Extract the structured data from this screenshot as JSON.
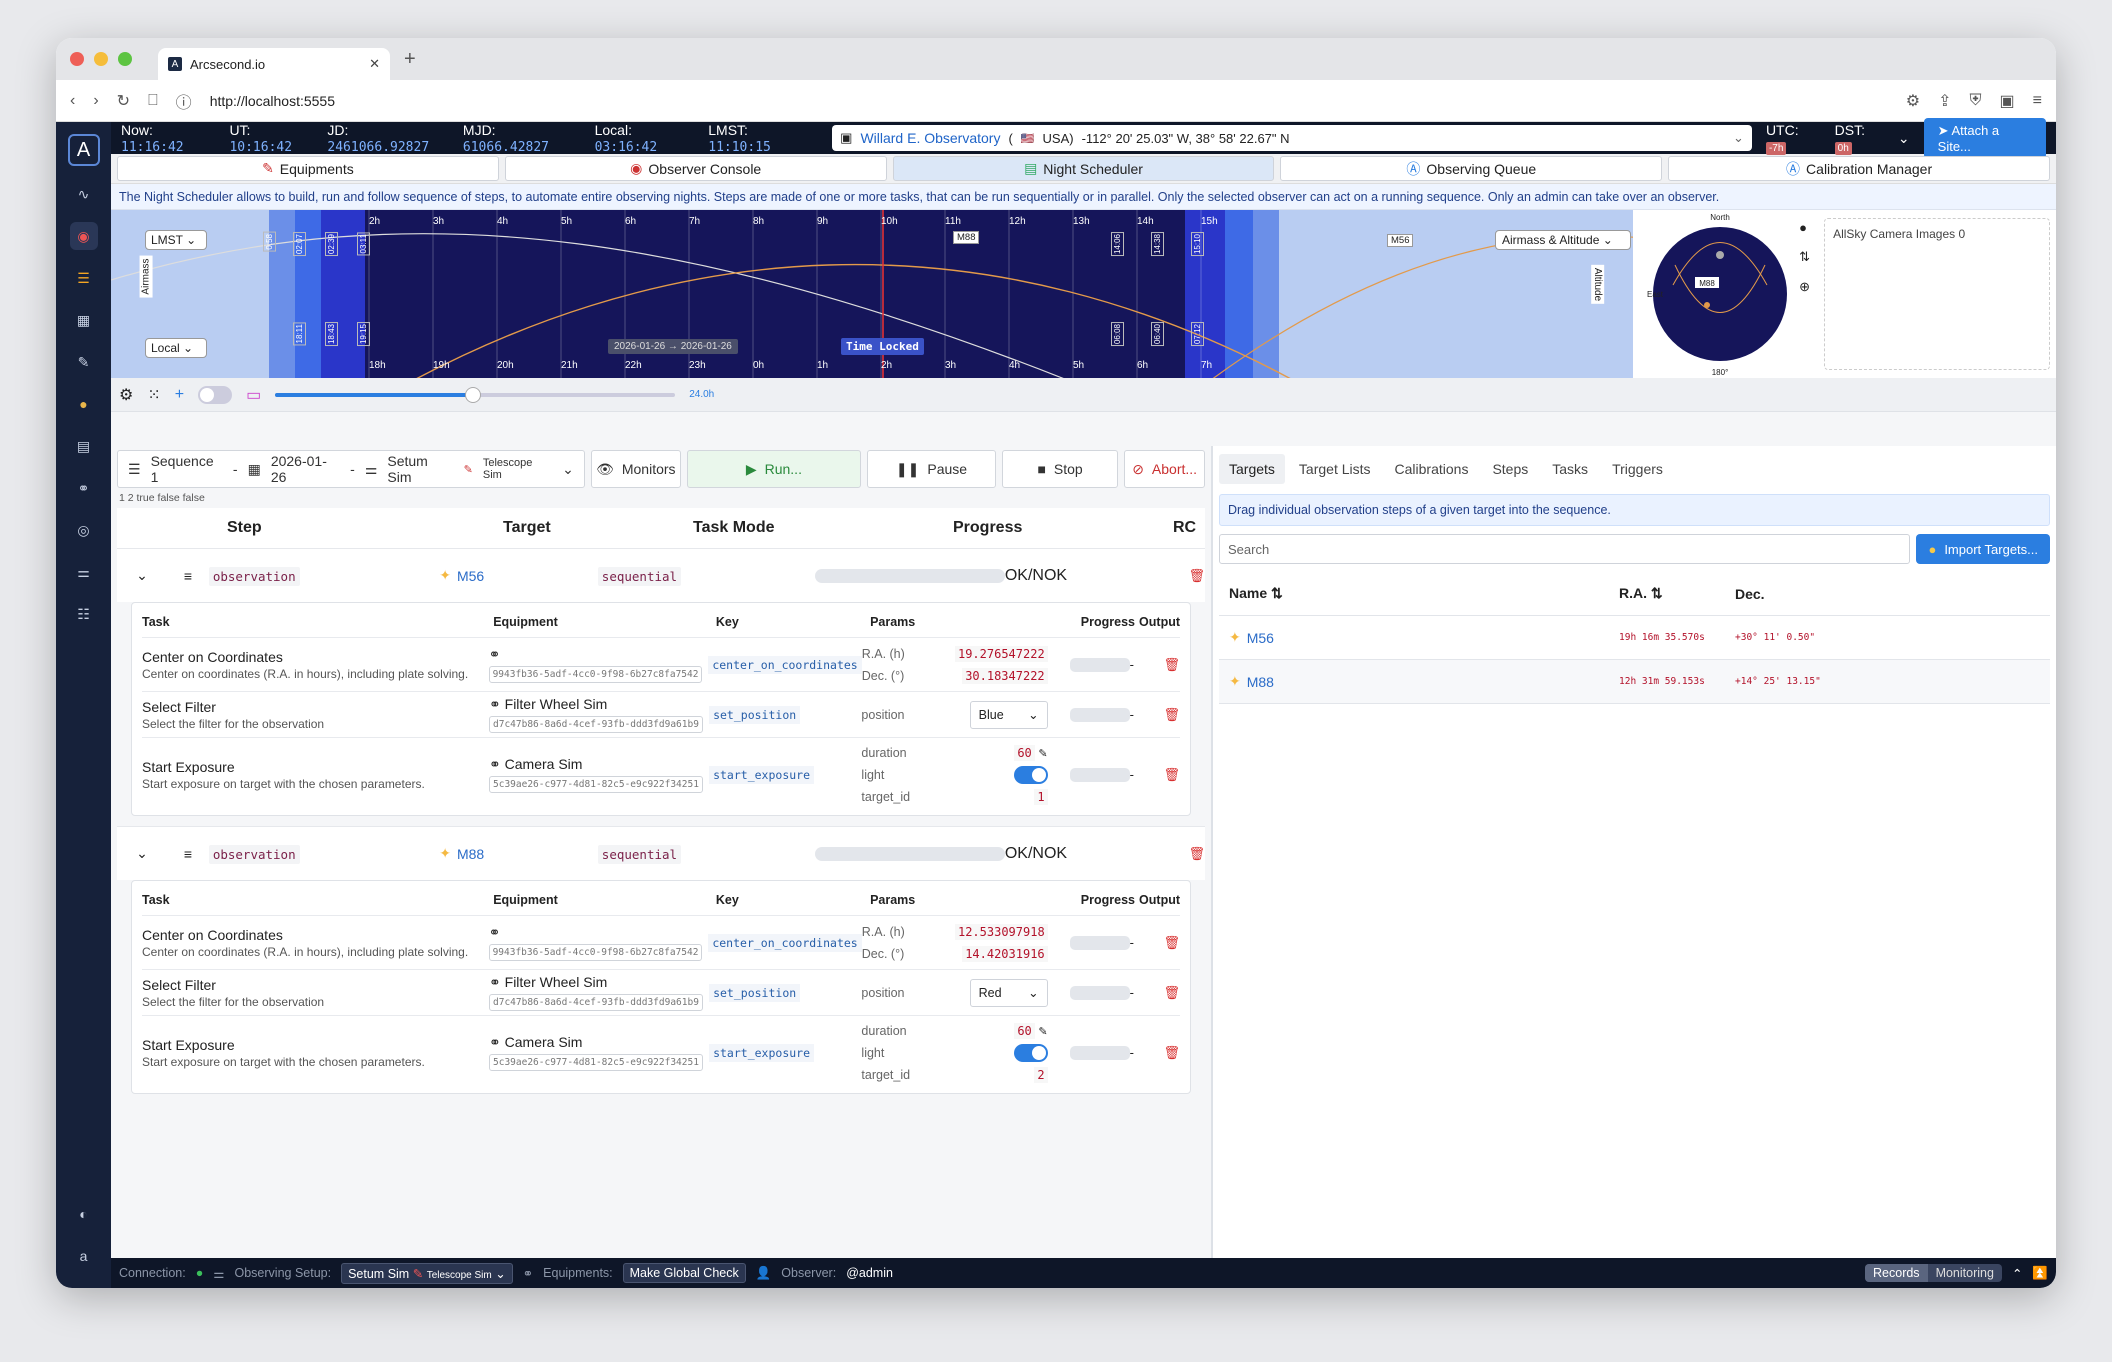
{
  "browser": {
    "tab_title": "Arcsecond.io",
    "url": "http://localhost:5555"
  },
  "topbar": {
    "now_label": "Now:",
    "now": "11:16:42",
    "ut_label": "UT:",
    "ut": "10:16:42",
    "jd_label": "JD:",
    "jd": "2461066.92827",
    "mjd_label": "MJD:",
    "mjd": "61066.42827",
    "local_label": "Local:",
    "local": "03:16:42",
    "lmst_label": "LMST:",
    "lmst": "11:10:15",
    "observatory": "Willard E. Observatory",
    "country": "USA)",
    "country_open": "(",
    "coords": "-112° 20' 25.03\" W, 38° 58' 22.67\" N",
    "utc_label": "UTC:",
    "utc_offset": "-7h",
    "dst_label": "DST:",
    "dst": "0h",
    "attach": "Attach a Site..."
  },
  "navtabs": [
    "Equipments",
    "Observer Console",
    "Night Scheduler",
    "Observing Queue",
    "Calibration Manager"
  ],
  "info": "The Night Scheduler allows to build, run and follow sequence of steps, to automate entire observing nights. Steps are made of one or more tasks, that can be run sequentially or in parallel. Only the selected observer can act on a running sequence. Only an admin can take over an observer.",
  "timeline": {
    "lmst_select": "LMST",
    "local_select": "Local",
    "airmass_select": "Airmass & Altitude",
    "airmass_axis": "Airmass",
    "altitude_axis": "Altitude",
    "hours_top": [
      "2h",
      "3h",
      "4h",
      "5h",
      "6h",
      "7h",
      "8h",
      "9h",
      "10h",
      "11h",
      "12h",
      "13h",
      "14h",
      "15h"
    ],
    "hours_bottom": [
      "18h",
      "19h",
      "20h",
      "21h",
      "22h",
      "23h",
      "0h",
      "1h",
      "2h",
      "3h",
      "4h",
      "5h",
      "6h",
      "7h"
    ],
    "twilight_top": [
      "0:58",
      "02:07",
      "02:39",
      "03:11",
      "14:06",
      "14:38",
      "15:10"
    ],
    "twilight_bottom": [
      "18:11",
      "18:43",
      "19:15",
      "06:08",
      "06:40",
      "07:12"
    ],
    "date_range": "2026-01-26 → 2026-01-26",
    "time_locked": "Time Locked",
    "labels": [
      "M88",
      "M56"
    ],
    "duration": "24.0h"
  },
  "sky": {
    "north": "North",
    "east": "East",
    "south": "180°",
    "target": "M88",
    "allsky": "AllSky Camera Images 0"
  },
  "controls": {
    "sequence": "Sequence 1",
    "sep": "-",
    "date": "2026-01-26",
    "setup": "Setum Sim",
    "scope": "Telescope Sim",
    "monitors": "Monitors",
    "run": "Run...",
    "pause": "Pause",
    "stop": "Stop",
    "abort": "Abort...",
    "hint": "1 2 true false false"
  },
  "step_headers": [
    "Step",
    "Target",
    "Task Mode",
    "Progress",
    "RC"
  ],
  "task_headers": [
    "Task",
    "Equipment",
    "Key",
    "Params",
    "Progress",
    "Output"
  ],
  "steps": [
    {
      "type": "observation",
      "target": "M56",
      "mode": "sequential",
      "rc": "OK/NOK",
      "tasks": [
        {
          "name": "Center on Coordinates",
          "desc": "Center on coordinates (R.A. in hours), including plate solving.",
          "equip": "",
          "uuid": "9943fb36-5adf-4cc0-9f98-6b27c8fa7542",
          "key": "center_on_coordinates",
          "params": [
            {
              "k": "R.A. (h)",
              "v": "19.276547222"
            },
            {
              "k": "Dec. (°)",
              "v": "30.18347222"
            }
          ],
          "out": "-"
        },
        {
          "name": "Select Filter",
          "desc": "Select the filter for the observation",
          "equip": "Filter Wheel Sim",
          "uuid": "d7c47b86-8a6d-4cef-93fb-ddd3fd9a61b9",
          "key": "set_position",
          "params": [
            {
              "k": "position",
              "v": "Blue"
            }
          ],
          "out": "-"
        },
        {
          "name": "Start Exposure",
          "desc": "Start exposure on target with the chosen parameters.",
          "equip": "Camera Sim",
          "uuid": "5c39ae26-c977-4d81-82c5-e9c922f34251",
          "key": "start_exposure",
          "params": [
            {
              "k": "duration",
              "v": "60"
            },
            {
              "k": "light",
              "v": "true"
            },
            {
              "k": "target_id",
              "v": "1"
            }
          ],
          "out": "-"
        }
      ]
    },
    {
      "type": "observation",
      "target": "M88",
      "mode": "sequential",
      "rc": "OK/NOK",
      "tasks": [
        {
          "name": "Center on Coordinates",
          "desc": "Center on coordinates (R.A. in hours), including plate solving.",
          "equip": "",
          "uuid": "9943fb36-5adf-4cc0-9f98-6b27c8fa7542",
          "key": "center_on_coordinates",
          "params": [
            {
              "k": "R.A. (h)",
              "v": "12.533097918"
            },
            {
              "k": "Dec. (°)",
              "v": "14.42031916"
            }
          ],
          "out": "-"
        },
        {
          "name": "Select Filter",
          "desc": "Select the filter for the observation",
          "equip": "Filter Wheel Sim",
          "uuid": "d7c47b86-8a6d-4cef-93fb-ddd3fd9a61b9",
          "key": "set_position",
          "params": [
            {
              "k": "position",
              "v": "Red"
            }
          ],
          "out": "-"
        },
        {
          "name": "Start Exposure",
          "desc": "Start exposure on target with the chosen parameters.",
          "equip": "Camera Sim",
          "uuid": "5c39ae26-c977-4d81-82c5-e9c922f34251",
          "key": "start_exposure",
          "params": [
            {
              "k": "duration",
              "v": "60"
            },
            {
              "k": "light",
              "v": "true"
            },
            {
              "k": "target_id",
              "v": "2"
            }
          ],
          "out": "-"
        }
      ]
    }
  ],
  "right": {
    "tabs": [
      "Targets",
      "Target Lists",
      "Calibrations",
      "Steps",
      "Tasks",
      "Triggers"
    ],
    "hint": "Drag individual observation steps of a given target into the sequence.",
    "search_placeholder": "Search",
    "import": "Import Targets...",
    "headers": {
      "name": "Name",
      "ra": "R.A.",
      "dec": "Dec."
    },
    "targets": [
      {
        "name": "M56",
        "ra": "19h 16m 35.570s",
        "dec": "+30° 11' 0.50\""
      },
      {
        "name": "M88",
        "ra": "12h 31m 59.153s",
        "dec": "+14° 25' 13.15\""
      }
    ]
  },
  "status": {
    "connection": "Connection:",
    "setup_label": "Observing Setup:",
    "setup": "Setum Sim",
    "scope": "Telescope Sim",
    "equip_label": "Equipments:",
    "global_check": "Make Global Check",
    "observer_label": "Observer:",
    "observer": "@admin",
    "records": "Records",
    "monitoring": "Monitoring"
  },
  "colors": {
    "accent": "#2b7ee0",
    "night": "#15155a",
    "danger": "#d83030"
  }
}
